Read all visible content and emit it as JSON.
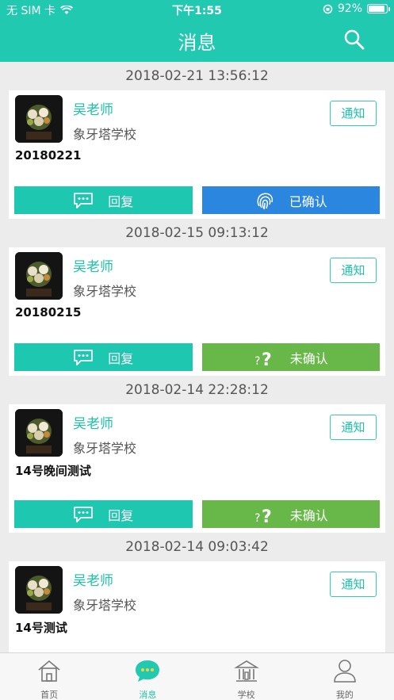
{
  "status_bar": {
    "carrier": "无 SIM 卡",
    "time": "下午1:55",
    "battery": "92%",
    "battery_level": 0.92
  },
  "header": {
    "title": "消息"
  },
  "messages": [
    {
      "timestamp": "2018-02-21 13:56:12",
      "sender": "吴老师",
      "school": "象牙塔学校",
      "tag": "通知",
      "content": "20180221",
      "reply_label": "回复",
      "status_label": "已确认",
      "status": "confirmed"
    },
    {
      "timestamp": "2018-02-15 09:13:12",
      "sender": "吴老师",
      "school": "象牙塔学校",
      "tag": "通知",
      "content": "20180215",
      "reply_label": "回复",
      "status_label": "未确认",
      "status": "unconfirmed"
    },
    {
      "timestamp": "2018-02-14 22:28:12",
      "sender": "吴老师",
      "school": "象牙塔学校",
      "tag": "通知",
      "content": "14号晚间测试",
      "reply_label": "回复",
      "status_label": "未确认",
      "status": "unconfirmed"
    },
    {
      "timestamp": "2018-02-14 09:03:42",
      "sender": "吴老师",
      "school": "象牙塔学校",
      "tag": "通知",
      "content": "14号测试"
    }
  ],
  "tabbar": {
    "tabs": [
      {
        "label": "首页",
        "icon": "home-icon"
      },
      {
        "label": "消息",
        "icon": "chat-icon",
        "active": true
      },
      {
        "label": "学校",
        "icon": "school-icon"
      },
      {
        "label": "我的",
        "icon": "user-icon"
      }
    ]
  },
  "colors": {
    "primary": "#22c9b1",
    "confirmed": "#2a86de",
    "unconfirmed": "#67b848"
  }
}
